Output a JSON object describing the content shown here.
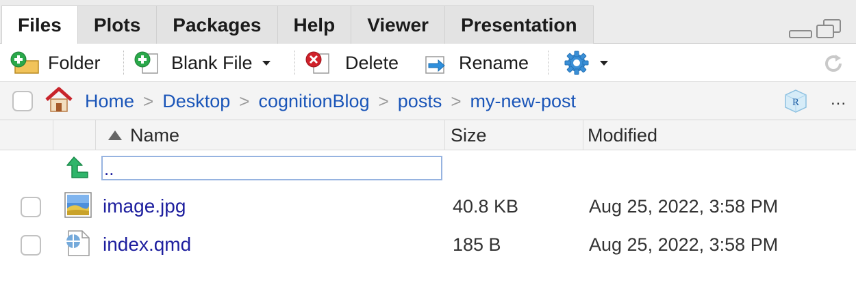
{
  "tabs": [
    {
      "label": "Files",
      "active": true
    },
    {
      "label": "Plots",
      "active": false
    },
    {
      "label": "Packages",
      "active": false
    },
    {
      "label": "Help",
      "active": false
    },
    {
      "label": "Viewer",
      "active": false
    },
    {
      "label": "Presentation",
      "active": false
    }
  ],
  "toolbar": {
    "folder_label": "Folder",
    "blank_file_label": "Blank File",
    "delete_label": "Delete",
    "rename_label": "Rename"
  },
  "breadcrumb": {
    "items": [
      "Home",
      "Desktop",
      "cognitionBlog",
      "posts",
      "my-new-post"
    ],
    "separator": ">",
    "more": "..."
  },
  "columns": {
    "name": "Name",
    "size": "Size",
    "modified": "Modified"
  },
  "parent_dir": "..",
  "files": [
    {
      "name": "image.jpg",
      "size": "40.8 KB",
      "modified": "Aug 25, 2022, 3:58 PM",
      "icon": "image-file-icon"
    },
    {
      "name": "index.qmd",
      "size": "185 B",
      "modified": "Aug 25, 2022, 3:58 PM",
      "icon": "quarto-file-icon"
    }
  ],
  "colors": {
    "link": "#1d1e9e",
    "crumb": "#1a55b8",
    "add_green": "#2aa84a",
    "delete_red": "#d0212a",
    "gear_blue": "#3a8fd6"
  }
}
